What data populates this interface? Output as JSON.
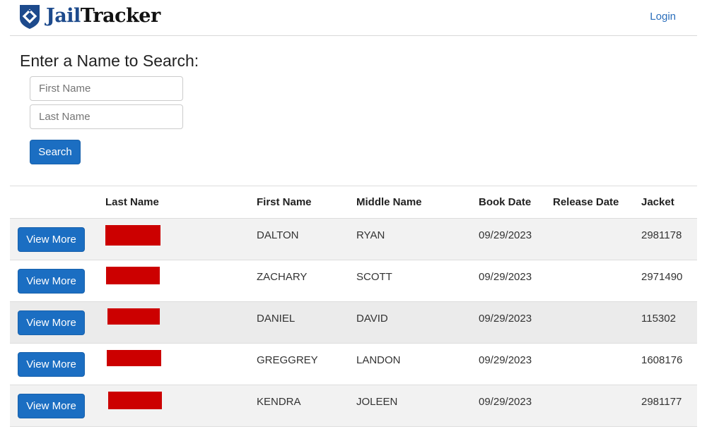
{
  "header": {
    "brand_part1": "Jail",
    "brand_part2": "Tracker",
    "logo_icon": "shield-icon",
    "login_label": "Login"
  },
  "search": {
    "heading": "Enter a Name to Search:",
    "first_name_placeholder": "First Name",
    "first_name_value": "",
    "last_name_placeholder": "Last Name",
    "last_name_value": "",
    "button_label": "Search"
  },
  "colors": {
    "brand": "#1d4a8c",
    "primary_button": "#1b6ec2",
    "link": "#2a6ebb",
    "redaction": "#cc0000"
  },
  "table": {
    "headers": [
      "",
      "Last Name",
      "First Name",
      "Middle Name",
      "Book Date",
      "Release Date",
      "Jacket"
    ],
    "rows": [
      {
        "action": "View More",
        "last_name_redacted": true,
        "first_name": "DALTON",
        "middle_name": "RYAN",
        "book_date": "09/29/2023",
        "release_date": "",
        "jacket": "2981178"
      },
      {
        "action": "View More",
        "last_name_redacted": true,
        "first_name": "ZACHARY",
        "middle_name": "SCOTT",
        "book_date": "09/29/2023",
        "release_date": "",
        "jacket": "2971490"
      },
      {
        "action": "View More",
        "last_name_redacted": true,
        "first_name": "DANIEL",
        "middle_name": "DAVID",
        "book_date": "09/29/2023",
        "release_date": "",
        "jacket": "115302"
      },
      {
        "action": "View More",
        "last_name_redacted": true,
        "first_name": "GREGGREY",
        "middle_name": "LANDON",
        "book_date": "09/29/2023",
        "release_date": "",
        "jacket": "1608176"
      },
      {
        "action": "View More",
        "last_name_redacted": true,
        "first_name": "KENDRA",
        "middle_name": "JOLEEN",
        "book_date": "09/29/2023",
        "release_date": "",
        "jacket": "2981177"
      }
    ]
  }
}
